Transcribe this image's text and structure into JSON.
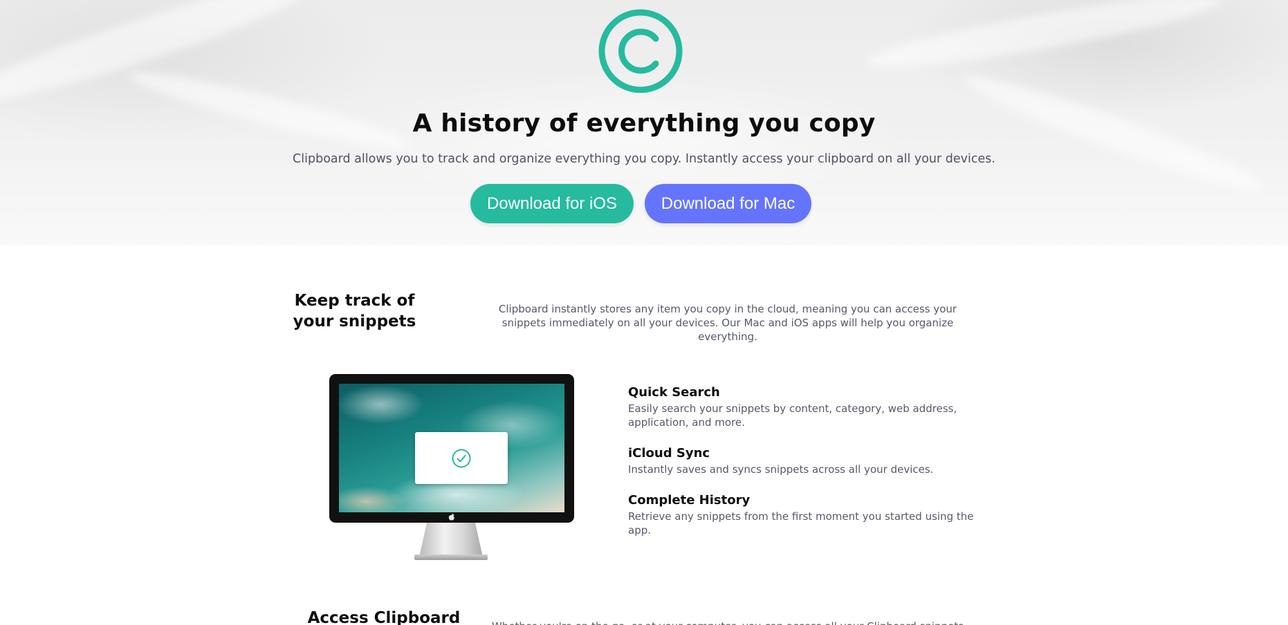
{
  "hero": {
    "logo_icon": "clipboard-copyright-icon",
    "title": "A history of everything you copy",
    "subtitle": "Clipboard allows you to track and organize everything you copy. Instantly access your clipboard on all your devices.",
    "buttons": {
      "ios_label": "Download for iOS",
      "mac_label": "Download for Mac"
    }
  },
  "snippets": {
    "title_line1": "Keep track of",
    "title_line2": "your snippets",
    "description": "Clipboard instantly stores any item you copy in the cloud, meaning you can access your snippets immediately on all your devices. Our Mac and iOS apps will help you organize everything."
  },
  "features": [
    {
      "title": "Quick Search",
      "description": "Easily search your snippets by content, category, web address, application, and more."
    },
    {
      "title": "iCloud Sync",
      "description": "Instantly saves and syncs snippets across all your devices."
    },
    {
      "title": "Complete History",
      "description": "Retrieve any snippets from the first moment you started using the app."
    }
  ],
  "access": {
    "title": "Access Clipboard",
    "description": "Whether you're on the go, or at your computer, you can access all your Clipboard snippets"
  },
  "colors": {
    "accent_teal": "#26ba9f",
    "accent_blue": "#6574fc",
    "heading": "#0d0d10",
    "body_text": "#55586a"
  }
}
